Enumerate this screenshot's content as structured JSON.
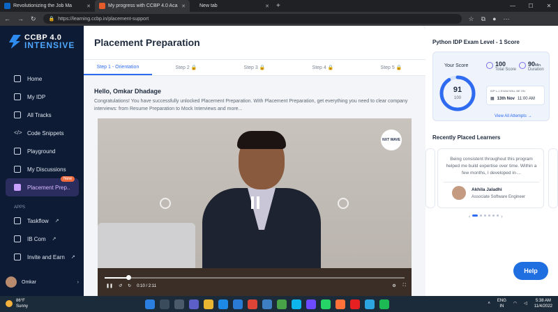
{
  "browser": {
    "tabs": [
      {
        "label": "Revolutionizing the Job Ma",
        "active": false
      },
      {
        "label": "My progress with CCBP 4.0 Aca",
        "active": true
      },
      {
        "label": "New tab",
        "active": false
      }
    ],
    "url": "https://learning.ccbp.in/placement-support"
  },
  "sidebar": {
    "logo_line1": "CCBP 4.0",
    "logo_line2": "INTENSIVE",
    "items": [
      {
        "label": "Home",
        "icon": "home-icon"
      },
      {
        "label": "My IDP",
        "icon": "idp-icon"
      },
      {
        "label": "All Tracks",
        "icon": "tracks-icon"
      },
      {
        "label": "Code Snippets",
        "icon": "code-icon"
      },
      {
        "label": "Playground",
        "icon": "playground-icon"
      },
      {
        "label": "My Discussions",
        "icon": "discussions-icon"
      },
      {
        "label": "Placement Prep..",
        "icon": "placement-icon",
        "badge": "New"
      }
    ],
    "apps_label": "APPS",
    "apps": [
      {
        "label": "Taskflow"
      },
      {
        "label": "IB Com"
      },
      {
        "label": "Invite and Earn"
      }
    ],
    "user_name": "Omkar"
  },
  "main": {
    "title": "Placement Preparation",
    "steps": [
      "Step 1 - Orientation",
      "Step 2",
      "Step 3",
      "Step 4",
      "Step 5"
    ],
    "greeting": "Hello, Omkar Dhadage",
    "message": "Congratulations! You have successfully unlocked Placement Preparation. With Placement Preparation, get everything you need to clear company interviews: from Resume Preparation to Mock Interviews and more...",
    "video": {
      "brand": "NXT WAVE",
      "time": "0:10 / 2:11",
      "progress": 0.08
    }
  },
  "right": {
    "exam_title": "Python IDP Exam Level - 1 Score",
    "your_score_label": "Your Score",
    "score": "91",
    "score_total": "100",
    "total_score_value": "100",
    "total_score_label": "Total Score",
    "duration_value": "90",
    "duration_unit": "Min.",
    "duration_label": "Duration",
    "exam_on_label": "IDP L-1 EXAM WILL BE ON",
    "exam_date": "13th Nov",
    "exam_time": "11:00 AM",
    "view_all": "View All Attempts",
    "recent_title": "Recently Placed Learners",
    "learner_quote": "Being consistent throughout this program helped me build expertise over time. Within a few months, I developed in-...",
    "learner_name": "Akhila Jaladhi",
    "learner_role": "Associate Software Engineer",
    "help": "Help"
  },
  "taskbar": {
    "temp": "86°F",
    "weather": "Sunny",
    "lang1": "ENG",
    "lang2": "IN",
    "time": "5:38 AM",
    "date": "11/4/2022"
  }
}
